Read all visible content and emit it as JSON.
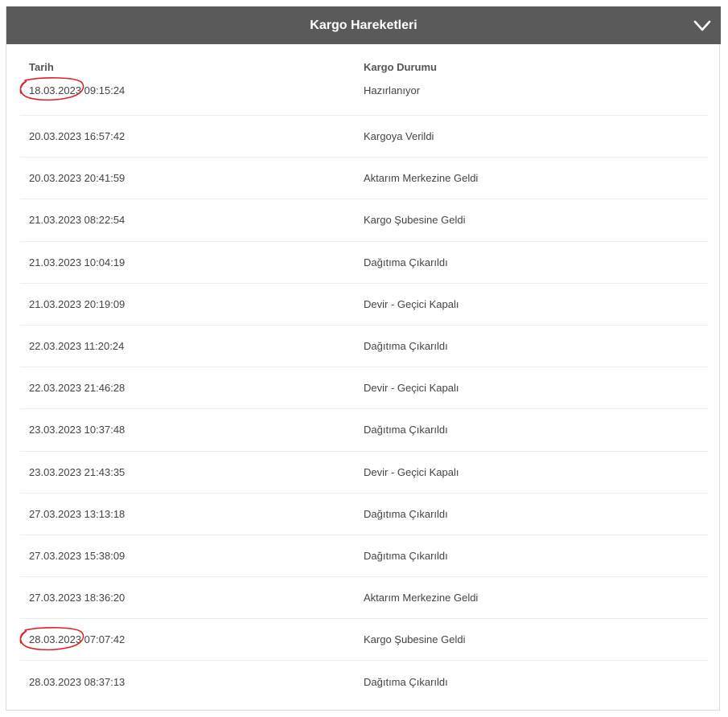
{
  "header": {
    "title": "Kargo Hareketleri",
    "toggle_icon": "chevron-down-icon"
  },
  "table": {
    "columns": [
      "Tarih",
      "Kargo Durumu"
    ],
    "rows": [
      {
        "date": "18.03.2023 09:15:24",
        "status": "Hazırlanıyor"
      },
      {
        "date": "20.03.2023 16:57:42",
        "status": "Kargoya Verildi"
      },
      {
        "date": "20.03.2023 20:41:59",
        "status": "Aktarım Merkezine Geldi"
      },
      {
        "date": "21.03.2023 08:22:54",
        "status": "Kargo Şubesine Geldi"
      },
      {
        "date": "21.03.2023 10:04:19",
        "status": "Dağıtıma Çıkarıldı"
      },
      {
        "date": "21.03.2023 20:19:09",
        "status": "Devir - Geçici Kapalı"
      },
      {
        "date": "22.03.2023 11:20:24",
        "status": "Dağıtıma Çıkarıldı"
      },
      {
        "date": "22.03.2023 21:46:28",
        "status": "Devir - Geçici Kapalı"
      },
      {
        "date": "23.03.2023 10:37:48",
        "status": "Dağıtıma Çıkarıldı"
      },
      {
        "date": "23.03.2023 21:43:35",
        "status": "Devir - Geçici Kapalı"
      },
      {
        "date": "27.03.2023 13:13:18",
        "status": "Dağıtıma Çıkarıldı"
      },
      {
        "date": "27.03.2023 15:38:09",
        "status": "Dağıtıma Çıkarıldı"
      },
      {
        "date": "27.03.2023 18:36:20",
        "status": "Aktarım Merkezine Geldi"
      },
      {
        "date": "28.03.2023 07:07:42",
        "status": "Kargo Şubesine Geldi"
      },
      {
        "date": "28.03.2023 08:37:13",
        "status": "Dağıtıma Çıkarıldı"
      }
    ]
  },
  "annotations": {
    "circled_rows": [
      0,
      13
    ],
    "color": "#e02020"
  },
  "colors": {
    "header_bg": "#5a5a5a",
    "header_text": "#ffffff",
    "row_divider": "#ececec"
  }
}
